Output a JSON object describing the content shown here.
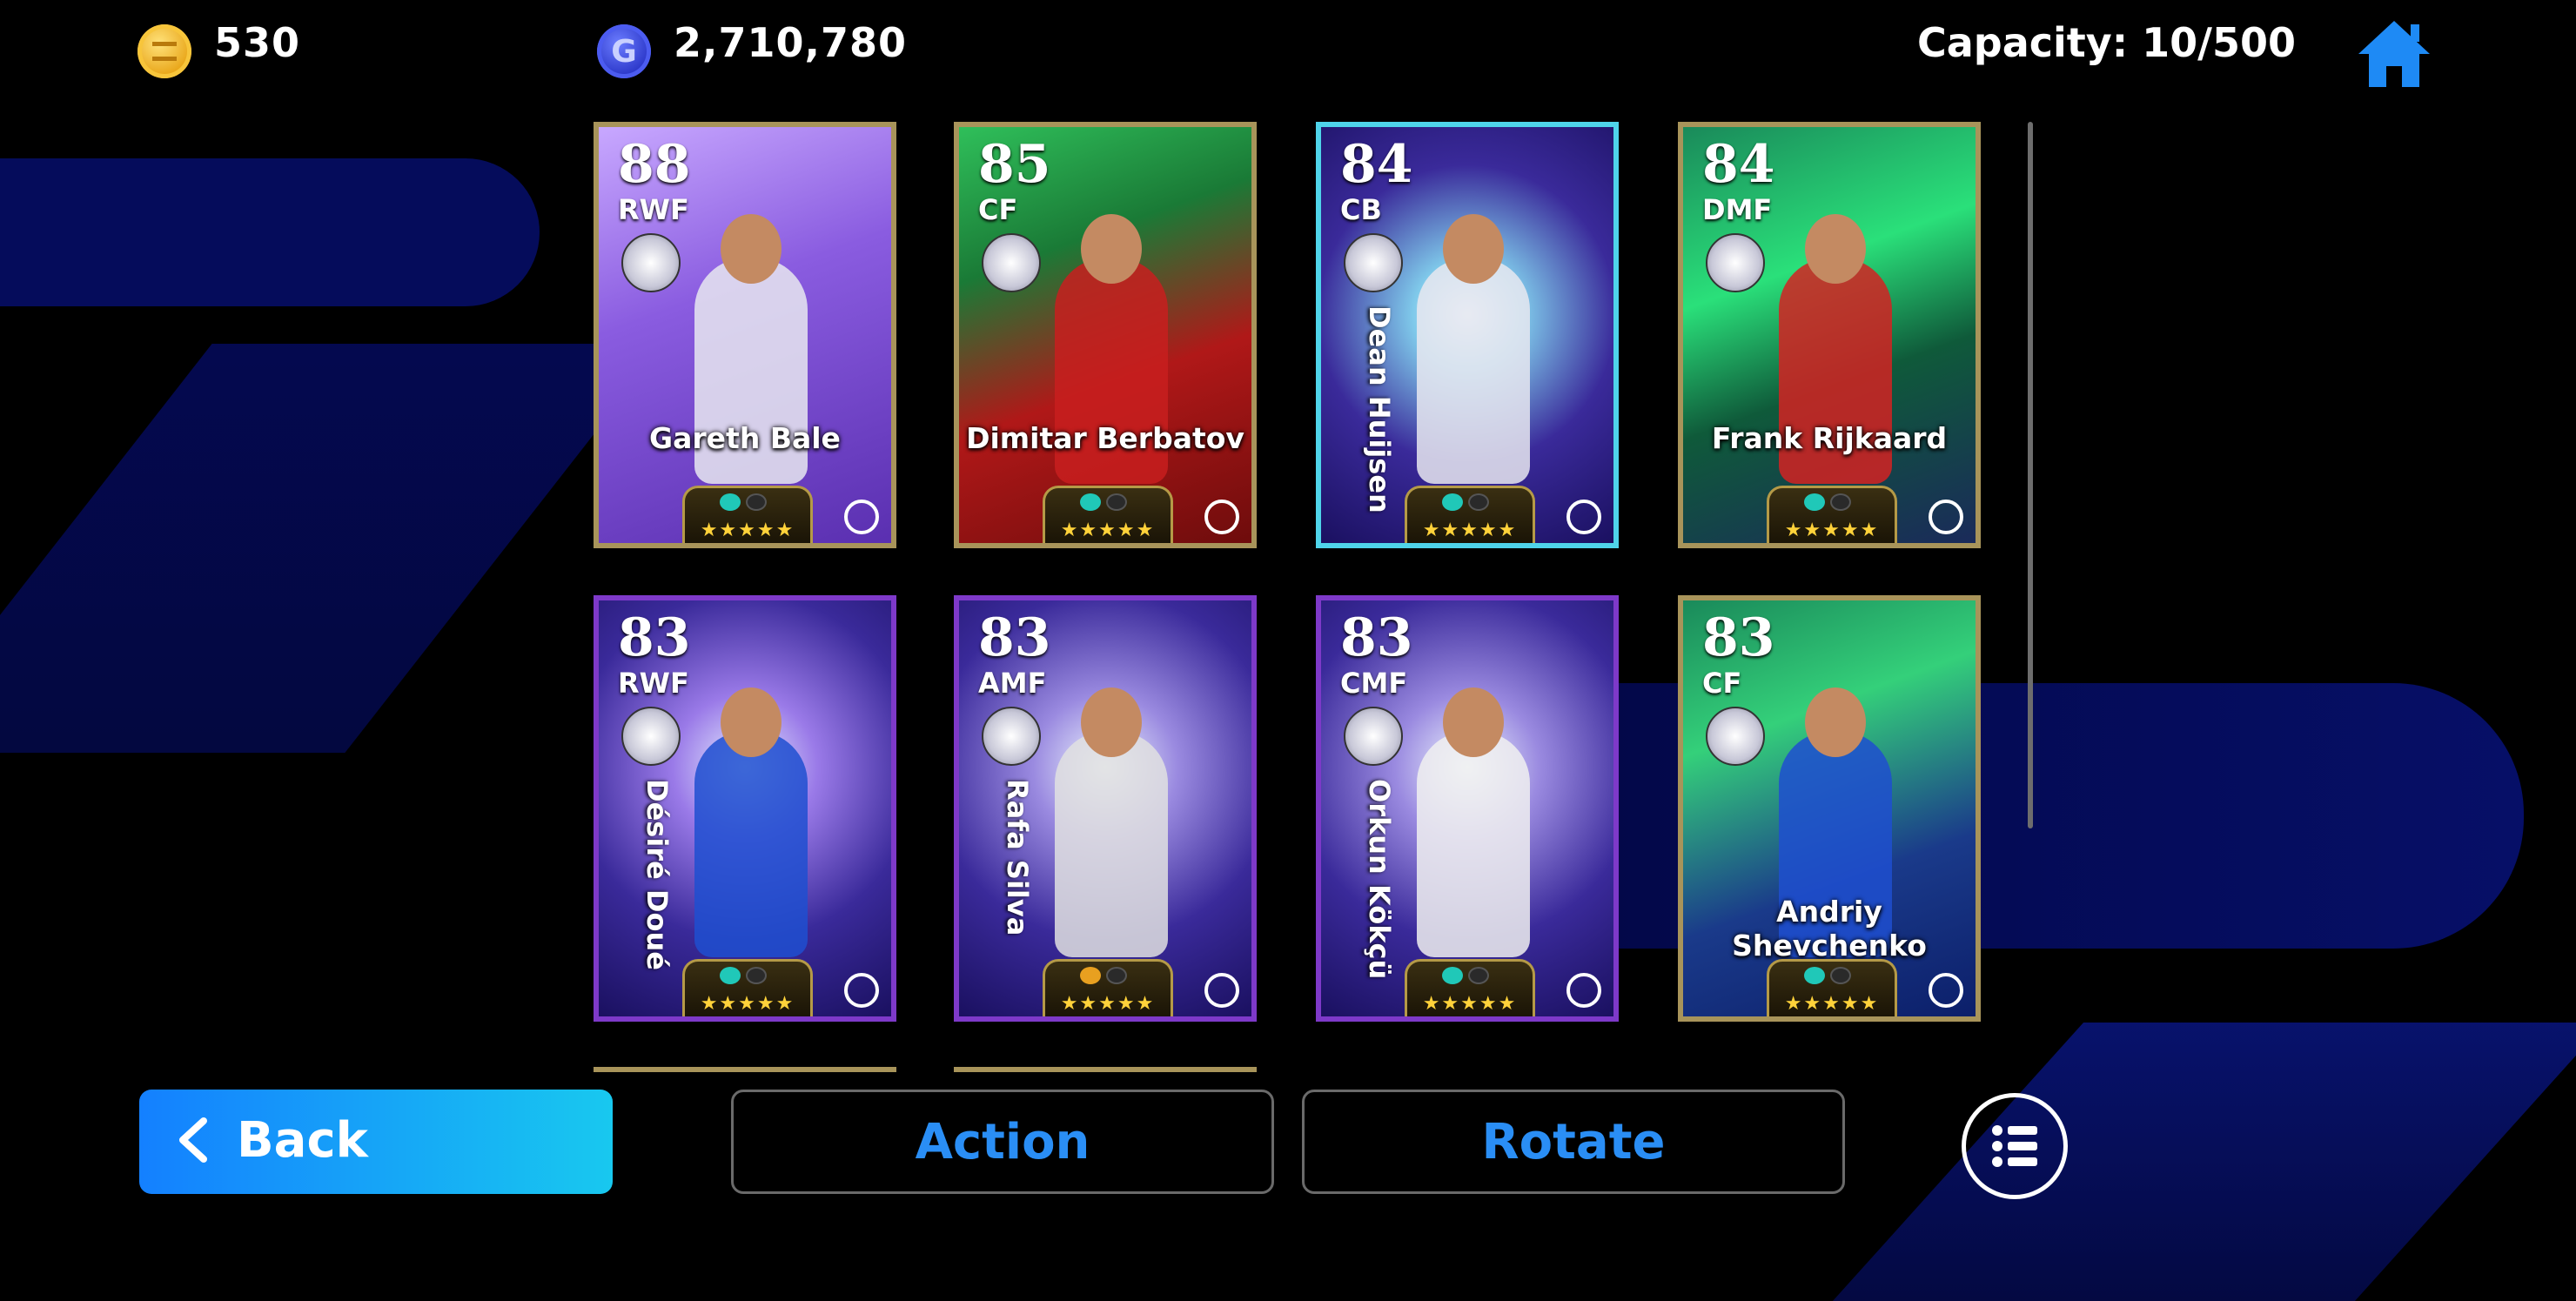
{
  "header": {
    "coins": "530",
    "gp": "2,710,780",
    "gp_icon_letter": "G",
    "capacity": "Capacity: 10/500"
  },
  "cards": [
    {
      "rating": "88",
      "position": "RWF",
      "name": "Gareth Bale",
      "frame": "gold",
      "name_style": "horizontal",
      "foot_icon": "teal"
    },
    {
      "rating": "85",
      "position": "CF",
      "name": "Dimitar Berbatov",
      "frame": "gold",
      "name_style": "horizontal",
      "foot_icon": "teal"
    },
    {
      "rating": "84",
      "position": "CB",
      "name": "Dean Huijsen",
      "frame": "cyan",
      "name_style": "vertical",
      "foot_icon": "teal"
    },
    {
      "rating": "84",
      "position": "DMF",
      "name": "Frank Rijkaard",
      "frame": "gold",
      "name_style": "horizontal",
      "foot_icon": "teal"
    },
    {
      "rating": "83",
      "position": "RWF",
      "name": "Désiré Doué",
      "frame": "purple",
      "name_style": "vertical",
      "foot_icon": "teal"
    },
    {
      "rating": "83",
      "position": "AMF",
      "name": "Rafa Silva",
      "frame": "purple",
      "name_style": "vertical",
      "foot_icon": "orange"
    },
    {
      "rating": "83",
      "position": "CMF",
      "name": "Orkun Kökçü",
      "frame": "purple",
      "name_style": "vertical",
      "foot_icon": "teal"
    },
    {
      "rating": "83",
      "position": "CF",
      "name": "Andriy Shevchenko",
      "frame": "gold",
      "name_style": "horizontal",
      "foot_icon": "teal"
    }
  ],
  "card_stars": "★★★★★",
  "buttons": {
    "back": "Back",
    "action": "Action",
    "rotate": "Rotate"
  },
  "colors": {
    "accent_blue": "#2a8ef5",
    "back_gradient_start": "#1480ff",
    "back_gradient_end": "#18c8ef",
    "background": "#000000",
    "card_gold": "#a8945a",
    "card_purple": "#7e39c9",
    "card_cyan": "#4fd4ea"
  },
  "icons": [
    "gold-coin-icon",
    "gp-coin-icon",
    "home-icon",
    "chevron-left-icon",
    "list-menu-icon"
  ]
}
